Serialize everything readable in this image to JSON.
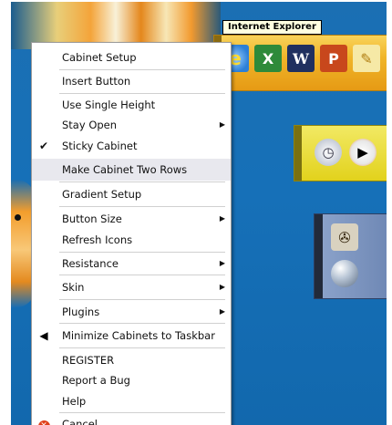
{
  "tooltip": "Internet Explorer",
  "cabinet1": {
    "icons": [
      "internet-explorer-icon",
      "excel-icon",
      "word-icon",
      "powerpoint-icon",
      "notepad-icon"
    ],
    "glyphs": [
      "e",
      "X",
      "W",
      "P",
      "✎"
    ]
  },
  "cabinet2": {
    "icons": [
      "clock-icon",
      "play-icon"
    ],
    "glyphs": [
      "◷",
      "▶"
    ]
  },
  "cabinet3": {
    "icons": [
      "film-reel-icon",
      "sphere-icon"
    ],
    "glyphs": [
      "✇",
      ""
    ]
  },
  "menu": {
    "items": [
      {
        "label": "Cabinet Setup"
      },
      {
        "label": "Insert Button"
      },
      {
        "label": "Use Single Height"
      },
      {
        "label": "Stay Open",
        "submenu": true
      },
      {
        "label": "Sticky Cabinet",
        "checked": true
      },
      {
        "label": "Make Cabinet Two Rows",
        "highlighted": true
      },
      {
        "label": "Gradient Setup"
      },
      {
        "label": "Button Size",
        "submenu": true
      },
      {
        "label": "Refresh Icons"
      },
      {
        "label": "Resistance",
        "submenu": true
      },
      {
        "label": "Skin",
        "submenu": true
      },
      {
        "label": "Plugins",
        "submenu": true
      },
      {
        "label": "Minimize Cabinets to Taskbar",
        "icon": "left-arrow-icon"
      },
      {
        "label": "REGISTER"
      },
      {
        "label": "Report a Bug"
      },
      {
        "label": "Help"
      },
      {
        "label": "Cancel",
        "icon": "cancel-icon"
      }
    ],
    "check_glyph": "✔",
    "arrow_glyph": "▶",
    "minimize_glyph": "◀",
    "cancel_glyph": "✕"
  },
  "colors": {
    "desktop": "#1670b8",
    "cabinet_orange": "#f0b52a",
    "cabinet_yellow": "#e2d21c",
    "cabinet_blue": "#6f88b5",
    "highlight": "#e8e8ee"
  }
}
